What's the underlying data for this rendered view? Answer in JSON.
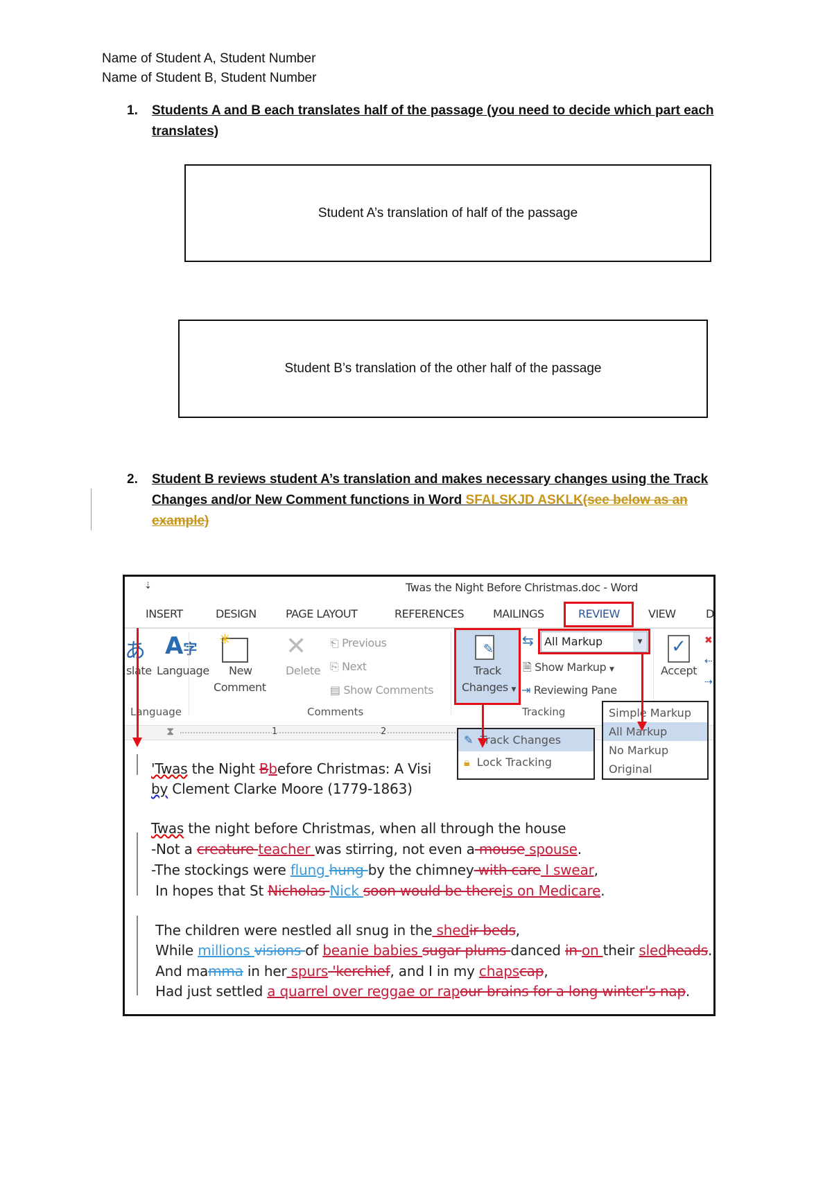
{
  "header": {
    "line1": "Name of Student A, Student Number",
    "line2": "Name of Student B, Student Number"
  },
  "item1": {
    "number": "1.",
    "line1": "Students A and B each translates half of the passage (you need to decide which part each ",
    "line2": "translates)"
  },
  "box_a": "Student A’s translation of half of the passage",
  "box_b": "Student B’s translation of the other half of the passage",
  "item2": {
    "number": "2.",
    "line1": "Student B reviews student A’s translation and makes necessary changes using the Track ",
    "line2": "Changes and/or New Comment functions in Word ",
    "inserted": "SFALSKJD ASKLK",
    "deleted_1": "(see below as an ",
    "deleted_2": "example)"
  },
  "colors": {
    "insert_red": "#c41e3a",
    "insert_blue": "#3b9ad9",
    "author_orange": "#c8951a",
    "highlight_red": "#e3101a"
  },
  "word": {
    "title": "Twas the Night Before Christmas.doc - Word",
    "qat": "⇣",
    "tabs": [
      "INSERT",
      "DESIGN",
      "PAGE LAYOUT",
      "REFERENCES",
      "MAILINGS",
      "REVIEW",
      "VIEW",
      "DI"
    ],
    "ribbon": {
      "translate": "slate",
      "language": "Language",
      "new_comment_1": "New",
      "new_comment_2": "Comment",
      "delete": "Delete",
      "previous": "Previous",
      "next": "Next",
      "show_comments": "Show Comments",
      "track_1": "Track",
      "track_2": "Changes",
      "markup_select": "All Markup",
      "show_markup": "Show Markup",
      "reviewing_pane": "Reviewing Pane",
      "accept": "Accept",
      "group_language": "Language",
      "group_comments": "Comments",
      "group_tracking": "Tracking"
    },
    "ruler": {
      "one": "1",
      "two": "2"
    },
    "track_menu": [
      "Track Changes",
      "Lock Tracking"
    ],
    "markup_menu": [
      "Simple Markup",
      "All Markup",
      "No Markup",
      "Original"
    ],
    "document": [
      [
        {
          "t": "'Twas",
          "c": "spell"
        },
        {
          "t": " the Night "
        },
        {
          "t": "B",
          "c": "del-red"
        },
        {
          "t": "b",
          "c": "ins-red"
        },
        {
          "t": "efore Christmas: A Visi"
        }
      ],
      [
        {
          "t": "by",
          "c": "spellb"
        },
        {
          "t": " Clement Clarke Moore (1779-1863)"
        }
      ],
      [
        {
          "t": "Twas",
          "c": "spell"
        },
        {
          "t": " the night before Christmas, when all through the house"
        }
      ],
      [
        {
          "t": "-Not a "
        },
        {
          "t": "creature ",
          "c": "del-red"
        },
        {
          "t": "teacher ",
          "c": "ins-red"
        },
        {
          "t": "was stirring, not even a"
        },
        {
          "t": " mouse",
          "c": "del-red"
        },
        {
          "t": " spouse",
          "c": "ins-red"
        },
        {
          "t": "."
        }
      ],
      [
        {
          "t": "-The stockings were "
        },
        {
          "t": "flung ",
          "c": "ins-blue"
        },
        {
          "t": "hung ",
          "c": "del-blue"
        },
        {
          "t": "by the chimney"
        },
        {
          "t": " with care",
          "c": "del-red"
        },
        {
          "t": " I swear",
          "c": "ins-red"
        },
        {
          "t": ","
        }
      ],
      [
        {
          "t": " In hopes that St "
        },
        {
          "t": "Nicholas ",
          "c": "del-red"
        },
        {
          "t": "Nick ",
          "c": "ins-blue"
        },
        {
          "t": "soon would be there",
          "c": "del-red"
        },
        {
          "t": "is on Medicare",
          "c": "ins-red"
        },
        {
          "t": "."
        }
      ],
      [
        {
          "t": " The children were nestled all snug in the"
        },
        {
          "t": " shed",
          "c": "ins-red"
        },
        {
          "t": "ir beds",
          "c": "del-red"
        },
        {
          "t": ","
        }
      ],
      [
        {
          "t": " While "
        },
        {
          "t": "millions ",
          "c": "ins-blue"
        },
        {
          "t": "visions ",
          "c": "del-blue"
        },
        {
          "t": "of "
        },
        {
          "t": "beanie babies ",
          "c": "ins-red"
        },
        {
          "t": "sugar plums ",
          "c": "del-red"
        },
        {
          "t": "danced "
        },
        {
          "t": "in ",
          "c": "del-red"
        },
        {
          "t": "on ",
          "c": "ins-red"
        },
        {
          "t": "their "
        },
        {
          "t": "sled",
          "c": "ins-red"
        },
        {
          "t": "heads",
          "c": "del-red"
        },
        {
          "t": "."
        }
      ],
      [
        {
          "t": " And ma"
        },
        {
          "t": "mma",
          "c": "del-blue"
        },
        {
          "t": " in her"
        },
        {
          "t": " spurs",
          "c": "ins-red"
        },
        {
          "t": " 'kerchief",
          "c": "del-red"
        },
        {
          "t": ", and I in my "
        },
        {
          "t": "chaps",
          "c": "ins-red"
        },
        {
          "t": "cap",
          "c": "del-red"
        },
        {
          "t": ","
        }
      ],
      [
        {
          "t": " Had just settled "
        },
        {
          "t": "a quarrel over reggae or rap",
          "c": "ins-red"
        },
        {
          "t": "our brains for a long winter's nap",
          "c": "del-red"
        },
        {
          "t": "."
        }
      ]
    ]
  }
}
